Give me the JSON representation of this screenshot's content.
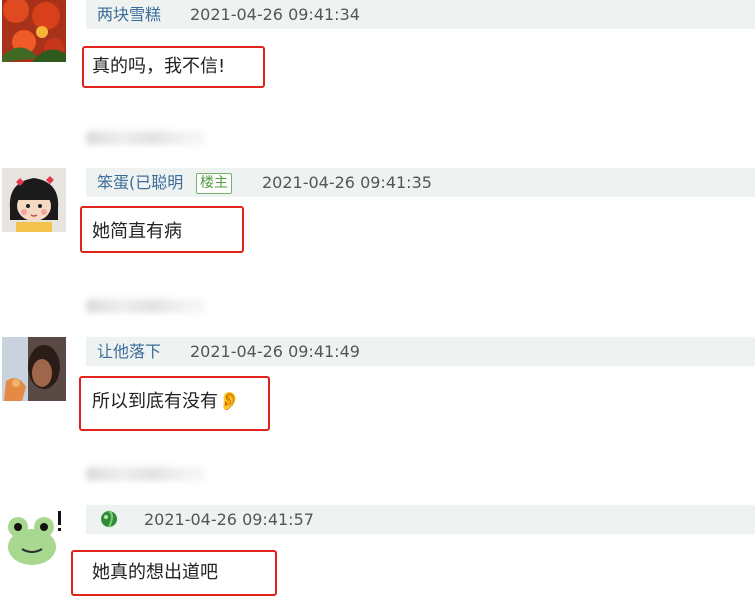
{
  "comments": [
    {
      "username": "两块雪糕",
      "time": "2021-04-26 09:41:34",
      "content": "真的吗，我不信!"
    },
    {
      "username": "笨蛋(已聪明",
      "badge": "楼主",
      "time": "2021-04-26 09:41:35",
      "content": "她简直有病"
    },
    {
      "username": "让他落下",
      "time": "2021-04-26 09:41:49",
      "content": "所以到底有没有👂"
    },
    {
      "username": "",
      "username_icon": "frog-leaf-icon",
      "time": "2021-04-26 09:41:57",
      "content": "她真的想出道吧"
    }
  ],
  "colors": {
    "username": "#3b6c9a",
    "highlight_box": "#e0231a",
    "meta_bar": "#eef3f1",
    "op_badge": "#4f9b43"
  }
}
